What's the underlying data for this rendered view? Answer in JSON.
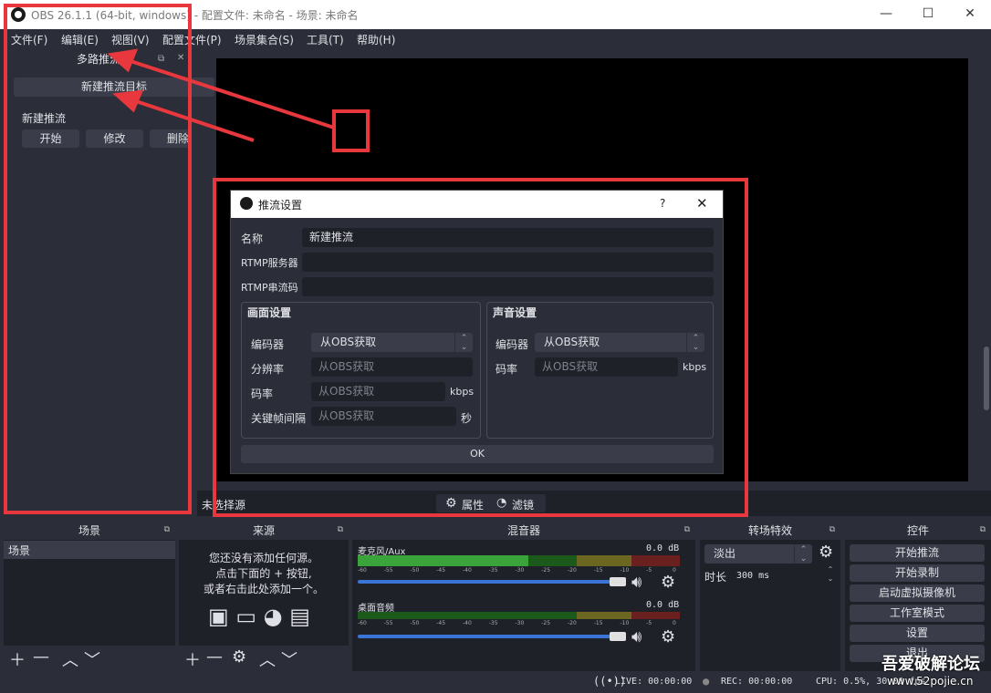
{
  "window": {
    "title": "OBS 26.1.1 (64-bit, windows) - 配置文件: 未命名 - 场景: 未命名",
    "minimize": "—",
    "maximize": "☐",
    "close": "✕"
  },
  "menu": [
    "文件(F)",
    "编辑(E)",
    "视图(V)",
    "配置文件(P)",
    "场景集合(S)",
    "工具(T)",
    "帮助(H)"
  ],
  "multistream": {
    "title": "多路推流",
    "new_target_button": "新建推流目标",
    "stream_name": "新建推流",
    "start_button": "开始",
    "edit_button": "修改",
    "delete_button": "删除"
  },
  "dialog": {
    "title": "推流设置",
    "help": "?",
    "close": "✕",
    "name_label": "名称",
    "name_value": "新建推流",
    "server_label": "RTMP服务器",
    "server_value": "",
    "key_label": "RTMP串流码",
    "key_value": "",
    "video_group_title": "画面设置",
    "audio_group_title": "声音设置",
    "video_encoder_label": "编码器",
    "video_encoder_value": "从OBS获取",
    "resolution_label": "分辨率",
    "resolution_placeholder": "从OBS获取",
    "video_bitrate_label": "码率",
    "video_bitrate_placeholder": "从OBS获取",
    "video_bitrate_unit": "kbps",
    "keyframe_label": "关键帧间隔",
    "keyframe_placeholder": "从OBS获取",
    "keyframe_unit": "秒",
    "audio_encoder_label": "编码器",
    "audio_encoder_value": "从OBS获取",
    "audio_bitrate_label": "码率",
    "audio_bitrate_placeholder": "从OBS获取",
    "audio_bitrate_unit": "kbps",
    "ok_button": "OK"
  },
  "source_strip": {
    "no_source": "未选择源",
    "properties": "属性",
    "filters": "滤镜"
  },
  "scenes": {
    "title": "场景",
    "items": [
      "场景"
    ]
  },
  "sources": {
    "title": "来源",
    "empty_line1": "您还没有添加任何源。",
    "empty_line2": "点击下面的 + 按钮,",
    "empty_line3": "或者右击此处添加一个。"
  },
  "mixer": {
    "title": "混音器",
    "channels": [
      {
        "name": "麦克风/Aux",
        "level": "0.0 dB"
      },
      {
        "name": "桌面音频",
        "level": "0.0 dB"
      }
    ],
    "scale": [
      "-60",
      "-55",
      "-50",
      "-45",
      "-40",
      "-35",
      "-30",
      "-25",
      "-20",
      "-15",
      "-10",
      "-5",
      "0"
    ]
  },
  "transitions": {
    "title": "转场特效",
    "selected": "淡出",
    "duration_label": "时长",
    "duration_value": "300 ms"
  },
  "controls": {
    "title": "控件",
    "start_streaming": "开始推流",
    "start_recording": "开始录制",
    "virtual_camera": "启动虚拟摄像机",
    "studio_mode": "工作室模式",
    "settings": "设置",
    "exit": "退出"
  },
  "status": {
    "live": "LIVE: 00:00:00",
    "rec": "REC: 00:00:00",
    "cpu": "CPU: 0.5%, 30.00 fps"
  },
  "watermark": {
    "line1": "吾爱破解论坛",
    "line2": "www.52pojie.cn"
  },
  "colors": {
    "accent": "#3a74d6",
    "annotation": "#e8383d",
    "background": "#2b2e38",
    "panel": "#1f2129"
  }
}
